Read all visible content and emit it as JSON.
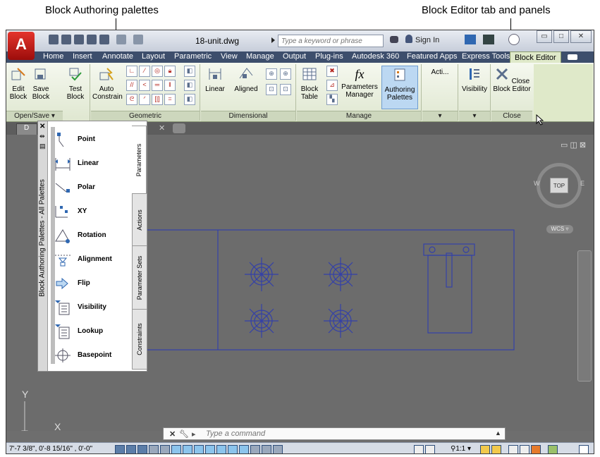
{
  "callouts": {
    "left": "Block Authoring palettes",
    "right": "Block Editor tab and panels"
  },
  "titlebar": {
    "filename": "18-unit.dwg",
    "search_placeholder": "Type a keyword or phrase",
    "signin": "Sign In"
  },
  "tabs": [
    "Home",
    "Insert",
    "Annotate",
    "Layout",
    "Parametric",
    "View",
    "Manage",
    "Output",
    "Plug-ins",
    "Autodesk 360",
    "Featured Apps",
    "Express Tools",
    "Block Editor"
  ],
  "ribbon": {
    "buttons": {
      "edit_block": "Edit Block",
      "save_block": "Save Block",
      "test_block": "Test Block",
      "auto_constrain": "Auto Constrain",
      "linear": "Linear",
      "aligned": "Aligned",
      "block_table": "Block Table",
      "parameters_manager": "Parameters Manager",
      "authoring_palettes": "Authoring Palettes",
      "actions": "Acti...",
      "visibility": "Visibility",
      "close_block_editor": "Close Block Editor"
    },
    "panels": {
      "open_save": "Open/Save",
      "geometric": "Geometric",
      "dimensional": "Dimensional",
      "manage": "Manage",
      "close": "Close"
    }
  },
  "doc_tab": "D",
  "palette": {
    "title": "Block Authoring Palettes - All Palettes",
    "items": [
      "Point",
      "Linear",
      "Polar",
      "XY",
      "Rotation",
      "Alignment",
      "Flip",
      "Visibility",
      "Lookup",
      "Basepoint"
    ],
    "tabs": [
      "Parameters",
      "Actions",
      "Parameter Sets",
      "Constraints"
    ]
  },
  "viewcube": {
    "top": "TOP",
    "west": "W",
    "east": "E",
    "wcs": "WCS"
  },
  "ucs": {
    "x": "X",
    "y": "Y"
  },
  "command": {
    "placeholder": "Type a command"
  },
  "status": {
    "coords": "7'-7 3/8\",  0'-8 15/16\" , 0'-0\"",
    "scale": "1:1"
  },
  "colors": {
    "accent": "#dfe9c9",
    "tabbar": "#3d4e6c",
    "drawing_bg": "#6c6c6c",
    "linework": "#3340a8"
  }
}
